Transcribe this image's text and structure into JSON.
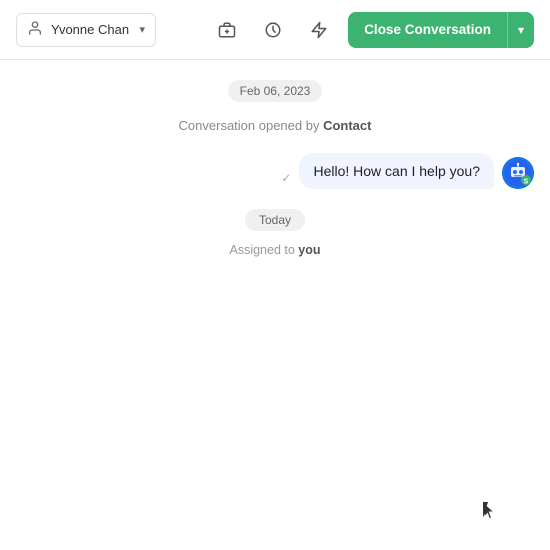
{
  "header": {
    "assignee": {
      "name": "Yvonne Chan",
      "icon": "👤"
    },
    "actions": [
      {
        "id": "suitcase",
        "icon": "💼",
        "label": "suitcase-icon"
      },
      {
        "id": "clock",
        "icon": "⏱",
        "label": "clock-icon"
      },
      {
        "id": "lightning",
        "icon": "⚡",
        "label": "lightning-icon"
      }
    ],
    "closeButton": {
      "main_label": "Close Conversation",
      "arrow_label": "▾"
    }
  },
  "chat": {
    "date_badge": "Feb 06, 2023",
    "system_message": {
      "prefix": "Conversation opened by ",
      "contact": "Contact"
    },
    "message": {
      "text": "Hello! How can I help you?",
      "checkmark": "✓"
    },
    "today_badge": "Today",
    "assigned_message": {
      "prefix": "Assigned to ",
      "you": "you"
    }
  },
  "icons": {
    "user": "person-icon",
    "chevron_down": "chevron-down-icon",
    "suitcase": "suitcase-icon",
    "clock": "clock-icon",
    "bolt": "bolt-icon",
    "bot_avatar": "bot-avatar",
    "checkmark": "checkmark-icon"
  },
  "colors": {
    "green": "#3cb371",
    "bubble_bg": "#eef1fb"
  }
}
